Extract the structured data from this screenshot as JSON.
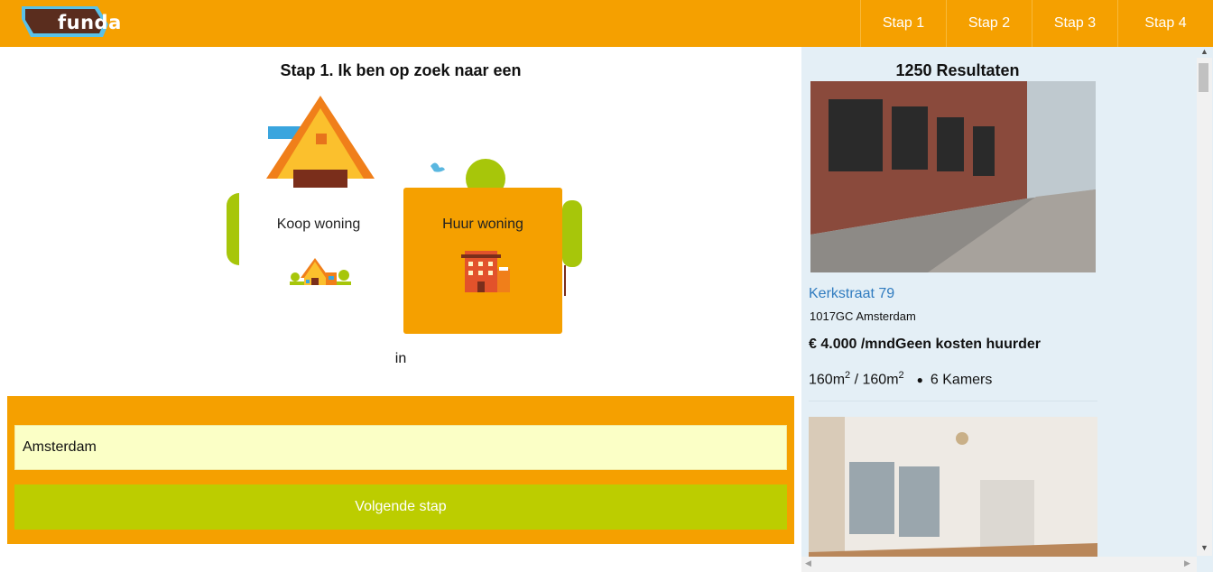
{
  "header": {
    "logo_text": "funda",
    "steps": [
      "Stap 1",
      "Stap 2",
      "Stap 3",
      "Stap 4"
    ],
    "colors": {
      "brand_orange": "#f5a000",
      "logo_blue": "#59c1e8",
      "logo_dark": "#5a2d1e"
    }
  },
  "main": {
    "title": "Stap 1. Ik ben op zoek naar een",
    "options": {
      "koop": {
        "label": "Koop woning",
        "icon": "house-icon"
      },
      "huur": {
        "label": "Huur woning",
        "icon": "apartment-building-icon"
      }
    },
    "selected_option": "huur",
    "in_label": "in",
    "location_value": "Amsterdam",
    "next_button": "Volgende stap"
  },
  "results": {
    "count_label": "1250 Resultaten",
    "listing": {
      "street": "Kerkstraat 79",
      "city": "1017GC Amsterdam",
      "price": "€ 4.000 /mndGeen kosten huurder",
      "area_1": "160m",
      "area_sep": " / ",
      "area_2": "160m",
      "rooms": "6 Kamers"
    }
  }
}
